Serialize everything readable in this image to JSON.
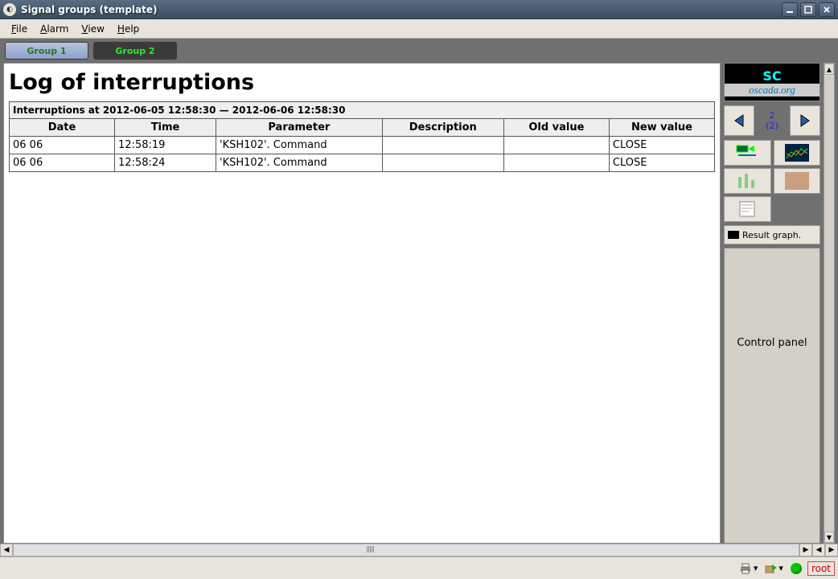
{
  "window": {
    "title": "Signal groups (template)"
  },
  "menu": {
    "file": "File",
    "alarm": "Alarm",
    "view": "View",
    "help": "Help"
  },
  "tabs": {
    "group1": "Group 1",
    "group2": "Group 2"
  },
  "log": {
    "title": "Log of interruptions",
    "range": "Interruptions at 2012-06-05 12:58:30 — 2012-06-06 12:58:30",
    "headers": {
      "date": "Date",
      "time": "Time",
      "parameter": "Parameter",
      "description": "Description",
      "old": "Old value",
      "new": "New value"
    },
    "rows": [
      {
        "date": "06 06",
        "time": "12:58:19",
        "parameter": "'KSH102'. Command",
        "description": "",
        "old": "",
        "new": "CLOSE"
      },
      {
        "date": "06 06",
        "time": "12:58:24",
        "parameter": "'KSH102'. Command",
        "description": "",
        "old": "",
        "new": "CLOSE"
      }
    ]
  },
  "side": {
    "logo_top": "SC",
    "logo_url": "oscada.org",
    "nav_page": "2",
    "nav_total": "(2)",
    "result_label": "Result graph.",
    "control_panel": "Control panel"
  },
  "status": {
    "user": "root"
  }
}
